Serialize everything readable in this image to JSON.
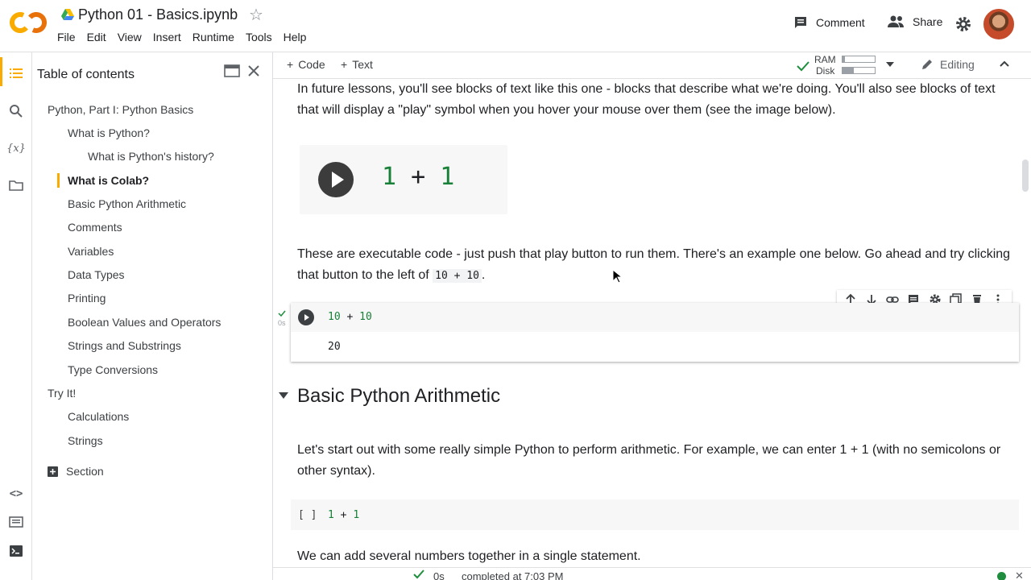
{
  "app": {
    "notebook_title": "Python 01 - Basics.ipynb",
    "menu": [
      "File",
      "Edit",
      "View",
      "Insert",
      "Runtime",
      "Tools",
      "Help"
    ],
    "comment_label": "Comment",
    "share_label": "Share"
  },
  "toc": {
    "title": "Table of contents",
    "items": [
      {
        "label": "Python, Part I: Python Basics",
        "level": 1
      },
      {
        "label": "What is Python?",
        "level": 2
      },
      {
        "label": "What is Python's history?",
        "level": 3
      },
      {
        "label": "What is Colab?",
        "level": 2,
        "active": true
      },
      {
        "label": "Basic Python Arithmetic",
        "level": 2
      },
      {
        "label": "Comments",
        "level": 2
      },
      {
        "label": "Variables",
        "level": 2
      },
      {
        "label": "Data Types",
        "level": 2
      },
      {
        "label": "Printing",
        "level": 2
      },
      {
        "label": "Boolean Values and Operators",
        "level": 2
      },
      {
        "label": "Strings and Substrings",
        "level": 2
      },
      {
        "label": "Type Conversions",
        "level": 2
      },
      {
        "label": "Try It!",
        "level": 1
      },
      {
        "label": "Calculations",
        "level": 2
      },
      {
        "label": "Strings",
        "level": 2
      }
    ],
    "add_section_label": "Section"
  },
  "toolbar": {
    "code_label": "Code",
    "text_label": "Text",
    "ram_label": "RAM",
    "disk_label": "Disk",
    "ram_usage": 0.08,
    "disk_usage": 0.35,
    "editing_label": "Editing"
  },
  "content": {
    "para1": "In future lessons, you'll see blocks of text like this one - blocks that describe what we're doing. You'll also see blocks of text that will display a \"play\" symbol when you hover your mouse over them (see the image below).",
    "demo_code": {
      "a": "1",
      "op": "+",
      "b": "1"
    },
    "para2_text": "These are executable code - just push that play button to run them. There's an example one below. Go ahead and try clicking that button to the left of",
    "para2_code": "10 + 10",
    "para2_end": ".",
    "cell1": {
      "code_a": "10",
      "code_op": "+",
      "code_b": "10",
      "output": "20",
      "exec_time": "0s"
    },
    "section_heading": "Basic Python Arithmetic",
    "para3": "Let's start out with some really simple Python to perform arithmetic. For example, we can enter 1 + 1 (with no semicolons or other syntax).",
    "cell2": {
      "bracket": "[ ]",
      "code_a": "1",
      "code_op": "+",
      "code_b": "1"
    },
    "para4": "We can add several numbers together in a single statement."
  },
  "status": {
    "exec_time": "0s",
    "text": "completed at 7:03 PM"
  },
  "colors": {
    "accent": "#f9ab00",
    "number": "#188038",
    "connected": "#1e8e3e"
  }
}
